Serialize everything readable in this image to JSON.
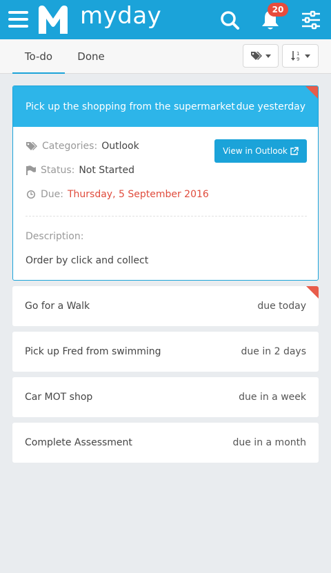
{
  "header": {
    "brand": "myday",
    "notification_count": "20",
    "bg_color": "#1ba3d9"
  },
  "tabs": [
    {
      "label": "To-do",
      "active": true
    },
    {
      "label": "Done",
      "active": false
    }
  ],
  "tasks": [
    {
      "title": "Pick up the shopping from the supermarket",
      "due": "due yesterday",
      "expanded": true,
      "overdue_flag": true,
      "categories_label": "Categories:",
      "categories_value": "Outlook",
      "status_label": "Status:",
      "status_value": "Not Started",
      "due_label": "Due:",
      "due_value": "Thursday, 5 September 2016",
      "view_button": "View in Outlook",
      "description_label": "Description:",
      "description_value": "Order by click and collect"
    },
    {
      "title": "Go for a Walk",
      "due": "due today",
      "overdue_flag": true
    },
    {
      "title": "Pick up Fred from swimming",
      "due": "due in 2 days"
    },
    {
      "title": "Car MOT shop",
      "due": "due in a week"
    },
    {
      "title": "Complete Assessment",
      "due": "due in a month"
    }
  ],
  "icons": {
    "menu": "hamburger-icon",
    "search": "search-icon",
    "notifications": "bell-icon",
    "filters": "sliders-icon",
    "tags": "tags-icon",
    "sort": "sort-icon",
    "external": "external-link-icon",
    "category": "tag-icon",
    "status": "flag-icon",
    "due": "clock-icon"
  },
  "colors": {
    "accent": "#2db5e9",
    "overdue": "#e85c4a",
    "due_text": "#e04b3c"
  }
}
